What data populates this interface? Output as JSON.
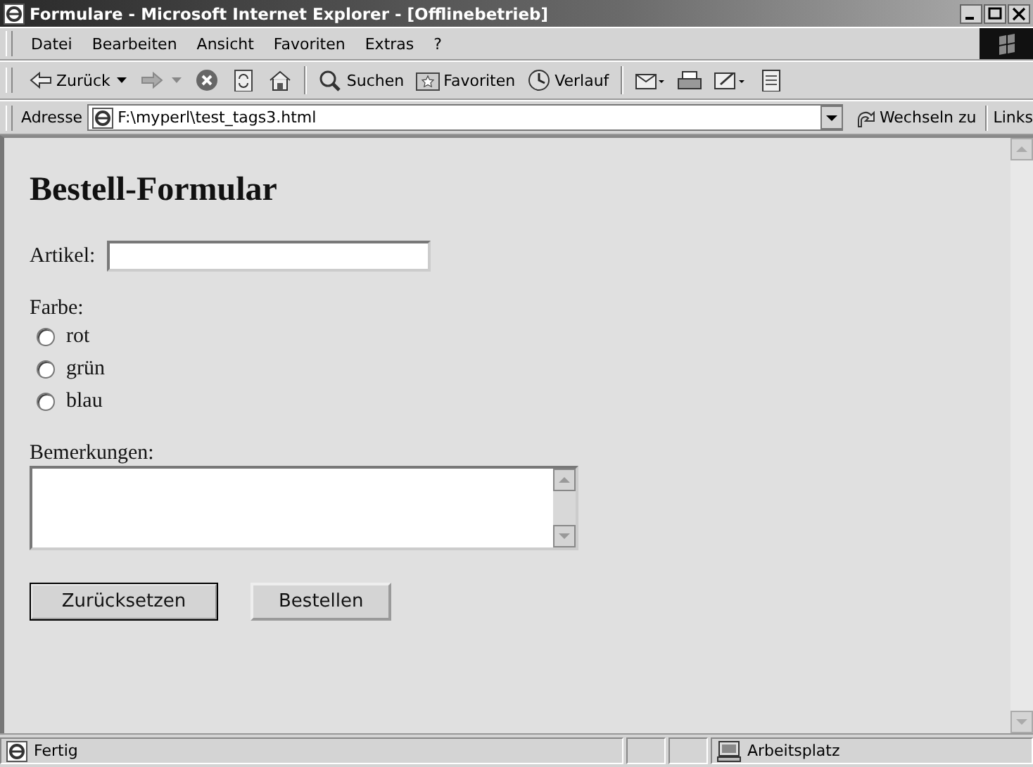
{
  "window": {
    "title": "Formulare - Microsoft Internet Explorer - [Offlinebetrieb]"
  },
  "menu": [
    "Datei",
    "Bearbeiten",
    "Ansicht",
    "Favoriten",
    "Extras",
    "?"
  ],
  "toolbar": [
    {
      "kind": "back",
      "label": "Zurück"
    },
    {
      "kind": "forward"
    },
    {
      "kind": "stop"
    },
    {
      "kind": "refresh"
    },
    {
      "kind": "home"
    },
    {
      "kind": "search",
      "label": "Suchen"
    },
    {
      "kind": "favorites",
      "label": "Favoriten"
    },
    {
      "kind": "history",
      "label": "Verlauf"
    },
    {
      "kind": "mail"
    },
    {
      "kind": "print"
    },
    {
      "kind": "edit"
    },
    {
      "kind": "discuss"
    }
  ],
  "address": {
    "label": "Adresse",
    "value": "F:\\myperl\\test_tags3.html",
    "go": "Wechseln zu",
    "links": "Links"
  },
  "page": {
    "heading": "Bestell-Formular",
    "article_label": "Artikel:",
    "color_label": "Farbe:",
    "colors": [
      {
        "label": "rot",
        "selected": false
      },
      {
        "label": "grün",
        "selected": false
      },
      {
        "label": "blau",
        "selected": false
      }
    ],
    "remarks_label": "Bemerkungen:",
    "buttons": [
      {
        "label": "Zurücksetzen",
        "default": true
      },
      {
        "label": "Bestellen",
        "default": false
      }
    ]
  },
  "status_bar": {
    "text": "Fertig",
    "zone": "Arbeitsplatz"
  }
}
